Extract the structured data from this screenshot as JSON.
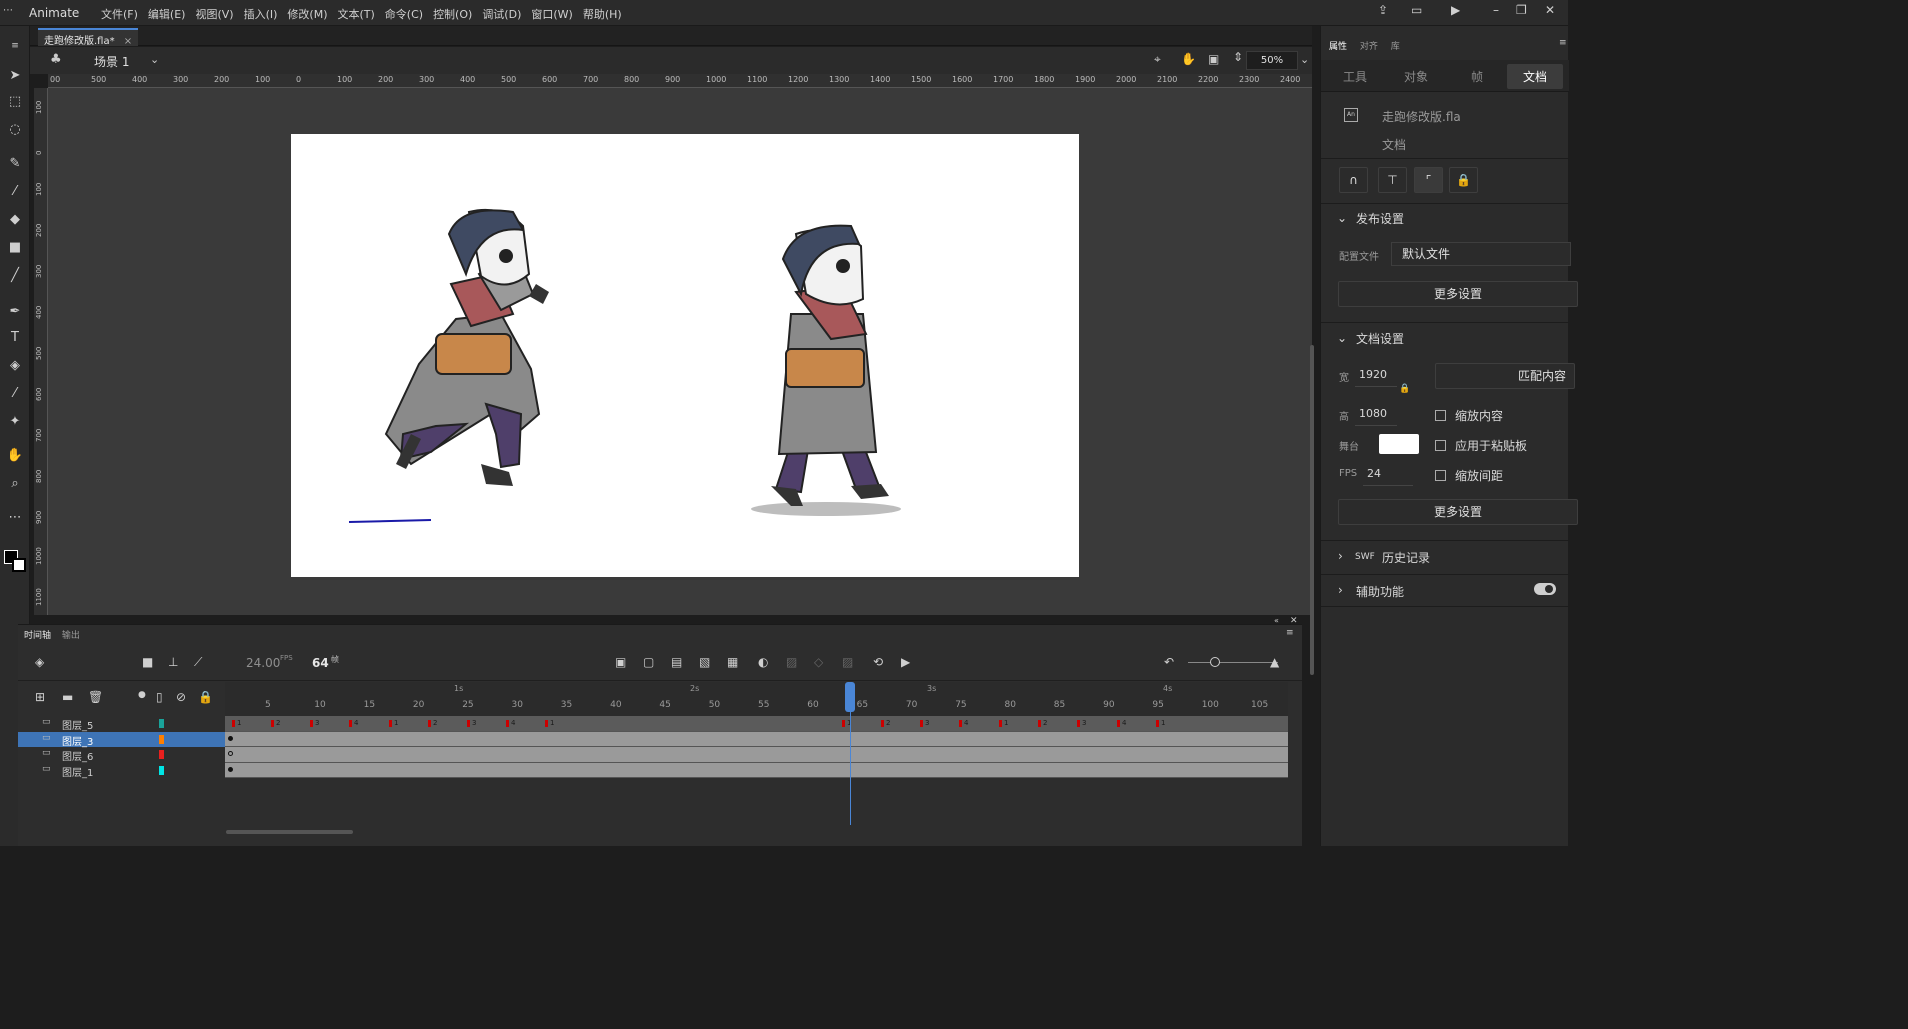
{
  "app": {
    "brand": "Animate",
    "menu": [
      "文件(F)",
      "编辑(E)",
      "视图(V)",
      "插入(I)",
      "修改(M)",
      "文本(T)",
      "命令(C)",
      "控制(O)",
      "调试(D)",
      "窗口(W)",
      "帮助(H)"
    ]
  },
  "document": {
    "tab_label": "走跑修改版.fla*",
    "scene_label": "场景 1",
    "zoom": "50%"
  },
  "rulers": {
    "horizontal": [
      "00",
      "500",
      "400",
      "300",
      "200",
      "100",
      "0",
      "100",
      "200",
      "300",
      "400",
      "500",
      "600",
      "700",
      "800",
      "900",
      "1000",
      "1100",
      "1200",
      "1300",
      "1400",
      "1500",
      "1600",
      "1700",
      "1800",
      "1900",
      "2000",
      "2100",
      "2200",
      "2300",
      "2400"
    ],
    "vertical": [
      "100",
      "0",
      "100",
      "200",
      "300",
      "400",
      "500",
      "600",
      "700",
      "800",
      "900",
      "1000",
      "1100"
    ]
  },
  "timeline": {
    "tabs": [
      "时间轴",
      "输出"
    ],
    "fps": "24.00",
    "fps_unit": "FPS",
    "current_frame": "64",
    "frame_unit": "帧",
    "seconds": [
      "1s",
      "2s",
      "3s",
      "4s"
    ],
    "frame_numbers": [
      "5",
      "10",
      "15",
      "20",
      "25",
      "30",
      "35",
      "40",
      "45",
      "50",
      "55",
      "60",
      "65",
      "70",
      "75",
      "80",
      "85",
      "90",
      "95",
      "100",
      "105"
    ],
    "layers": [
      {
        "name": "图层_5",
        "color": "#1aa39a",
        "selected": false
      },
      {
        "name": "图层_3",
        "color": "#ff7f00",
        "selected": true
      },
      {
        "name": "图层_6",
        "color": "#e8201e",
        "selected": false
      },
      {
        "name": "图层_1",
        "color": "#00e5e5",
        "selected": false
      }
    ],
    "keyframe_labels": [
      "1",
      "2",
      "3",
      "4",
      "1",
      "2",
      "3",
      "4",
      "1",
      "1",
      "2",
      "3",
      "4",
      "1",
      "2",
      "3",
      "4",
      "1"
    ]
  },
  "properties": {
    "top_tabs": [
      "属性",
      "对齐",
      "库"
    ],
    "sub_tabs": [
      "工具",
      "对象",
      "帧",
      "文档"
    ],
    "file_name": "走跑修改版.fla",
    "file_type": "文档",
    "publish_header": "发布设置",
    "profile_label": "配置文件",
    "profile_value": "默认文件",
    "more_settings": "更多设置",
    "doc_settings_header": "文档设置",
    "width_label": "宽",
    "width_value": "1920",
    "height_label": "高",
    "height_value": "1080",
    "stage_label": "舞台",
    "fps_label": "FPS",
    "fps_value": "24",
    "match_contents": "匹配内容",
    "scale_content": "缩放内容",
    "apply_pasteboard": "应用于粘贴板",
    "scale_spacing": "缩放间距",
    "more_settings_2": "更多设置",
    "swf_prefix": "SWF",
    "swf_history": "历史记录",
    "accessibility": "辅助功能",
    "stage_color": "#ffffff"
  }
}
